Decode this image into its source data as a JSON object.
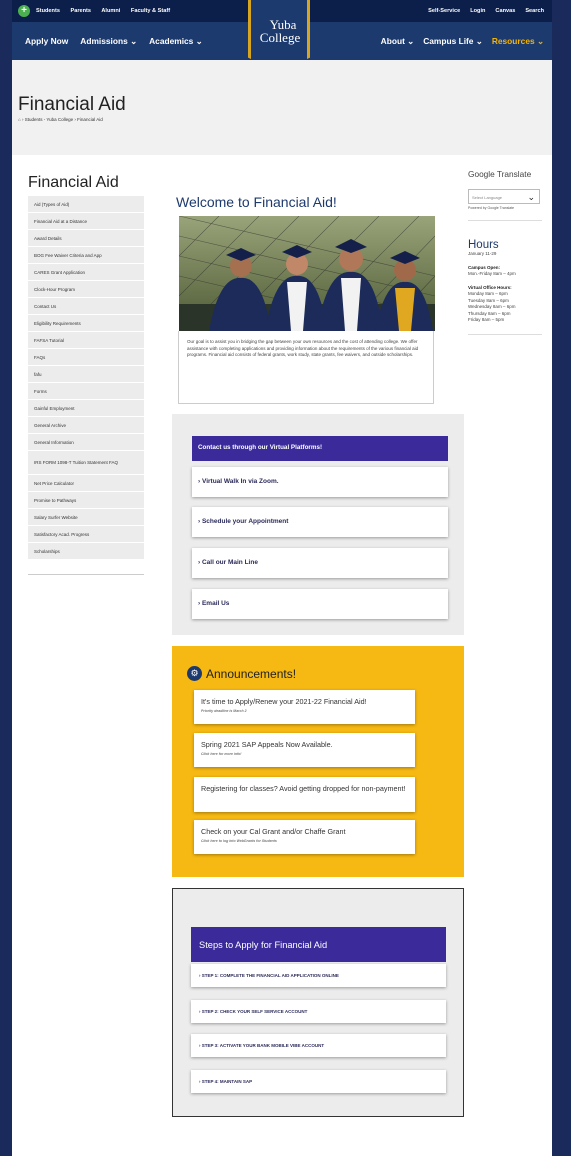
{
  "topbar": {
    "left_links": [
      "Students",
      "Parents",
      "Alumni",
      "Faculty & Staff"
    ],
    "right_links": [
      "Self-Service",
      "Login",
      "Canvas",
      "Search"
    ]
  },
  "mainnav": {
    "left": [
      "Apply Now",
      "Admissions ⌄",
      "Academics ⌄"
    ],
    "right": [
      "About ⌄",
      "Campus Life ⌄",
      "Resources ⌄"
    ]
  },
  "logo": {
    "line1": "Yuba",
    "line2": "College"
  },
  "hero": {
    "title": "Financial Aid",
    "breadcrumb": "› Students - Yuba College  › Financial Aid"
  },
  "sidebar": {
    "title": "Financial Aid",
    "items": [
      "Aid (Types of Aid)",
      "Financial Aid at a Distance",
      "Award Details",
      "BOG Fee Waiver Criteria and App",
      "CARES Grant Application",
      "Clock-Hour Program",
      "Contact Us",
      "Eligibility Requirements",
      "FAFSA Tutorial",
      "FAQs",
      "fafu",
      "Forms",
      "Gainful Employment",
      "General Archive",
      "General Information",
      "IRS FORM 1098-T Tuition Statement FAQ",
      "Net Price Calculator",
      "Promise to Pathways",
      "Salary Surfer Website",
      "Satisfactory Acad. Progress",
      "Scholarships"
    ]
  },
  "welcome": {
    "title": "Welcome to Financial Aid!",
    "body": "Our goal is to assist you in bridging the gap between your own resources and the cost of attending college. We offer assistance with completing applications and providing information about the requirements of the various financial aid programs. Financial aid consists of federal grants, work study, state grants, fee waivers, and outside scholarships."
  },
  "virtual": {
    "heading": "Contact us through our Virtual Platforms!",
    "buttons": [
      "› Virtual Walk In via Zoom.",
      "› Schedule your Appointment",
      "› Call our Main Line",
      "› Email Us"
    ]
  },
  "announcements": {
    "heading": "Announcements!",
    "cards": [
      {
        "title": "It's time to Apply/Renew your 2021-22 Financial Aid!",
        "sub": "Priority deadline is March 2"
      },
      {
        "title": "Spring 2021 SAP Appeals Now Available.",
        "sub": "Click here for more info!"
      },
      {
        "title": "Registering for classes? Avoid getting dropped for non-payment!",
        "sub": ""
      },
      {
        "title": "Check on your Cal Grant and/or Chaffe Grant",
        "sub": "Click here to log into WebGrants for Students"
      }
    ]
  },
  "steps": {
    "heading": "Steps to Apply for Financial Aid",
    "items": [
      "› STEP 1: COMPLETE THE FINANCIAL AID APPLICATION ONLINE",
      "› STEP 2: CHECK YOUR SELF SERVICE ACCOUNT",
      "› STEP 3: ACTIVATE YOUR BANK MOBILE VIBE ACCOUNT",
      "› STEP 4: MAINTAIN SAP"
    ]
  },
  "right": {
    "translate_title": "Google Translate",
    "select_placeholder": "Select Language",
    "powered": "Powered by Google Translate",
    "hours_title": "Hours",
    "dates": "January 11-29",
    "campus_open_label": "Campus Open:",
    "campus_open": "Mon.-Friday 8am – 4pm",
    "virtual_label": "Virtual Office Hours:",
    "virtual_hours": [
      "Monday 8am – 6pm",
      "Tuesday 8am – 6pm",
      "Wednesday 8am – 6pm",
      "Thursday 8am – 6pm",
      "Friday 8am – 5pm"
    ]
  }
}
